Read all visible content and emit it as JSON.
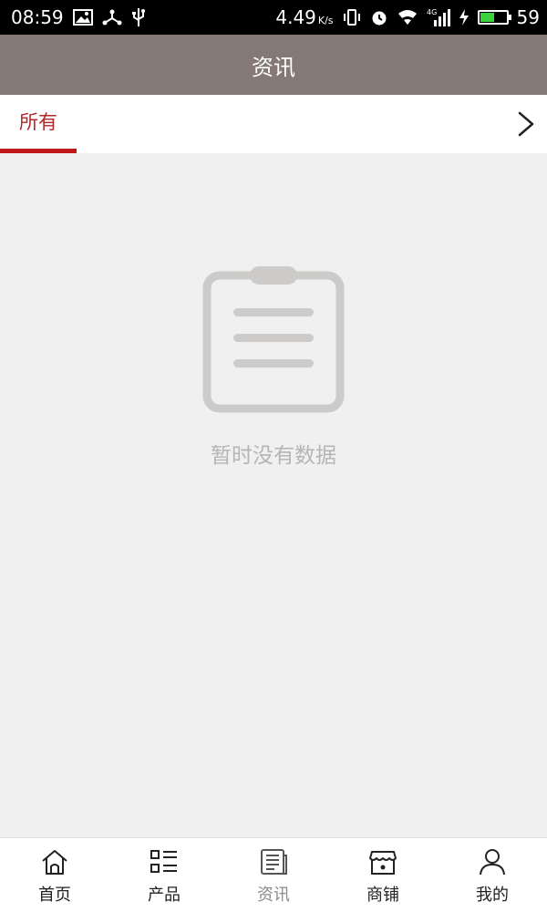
{
  "status_bar": {
    "time": "08:59",
    "speed": "4.49",
    "speed_unit": "K/s",
    "network": "4G",
    "battery": "59",
    "battery_level_percent": 59,
    "battery_color": "#3bd33b"
  },
  "header": {
    "title": "资讯",
    "background": "#857975"
  },
  "tabs": {
    "items": [
      {
        "label": "所有",
        "active": true
      }
    ],
    "accent": "#c01818",
    "more_icon": "chevron-right-icon"
  },
  "empty_state": {
    "icon": "clipboard-icon",
    "message": "暂时没有数据"
  },
  "bottom_nav": {
    "items": [
      {
        "label": "首页",
        "icon": "home-icon",
        "active": false
      },
      {
        "label": "产品",
        "icon": "list-icon",
        "active": false
      },
      {
        "label": "资讯",
        "icon": "news-icon",
        "active": true
      },
      {
        "label": "商铺",
        "icon": "store-icon",
        "active": false
      },
      {
        "label": "我的",
        "icon": "user-icon",
        "active": false
      }
    ]
  }
}
